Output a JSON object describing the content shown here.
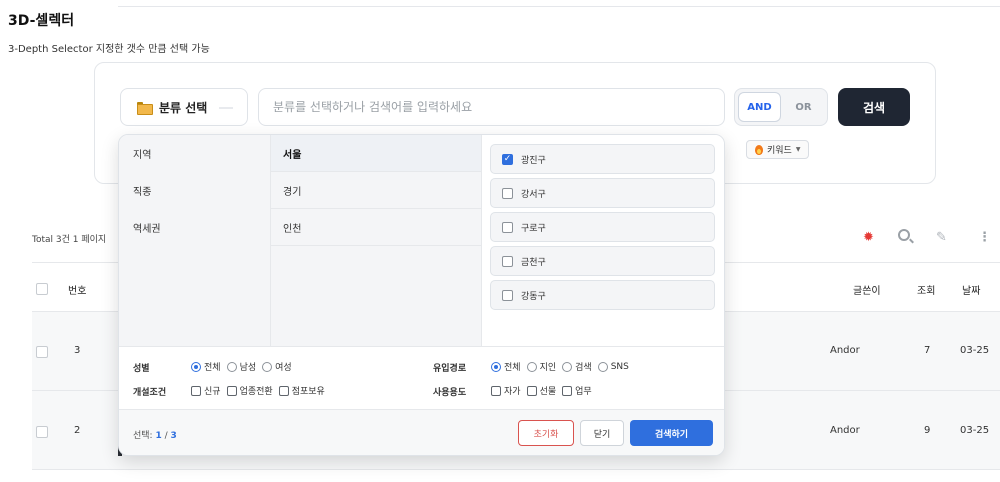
{
  "page": {
    "title": "3D-셀렉터",
    "description": "3-Depth Selector 지정한 갯수 만큼 선택 가능"
  },
  "search": {
    "category_button_label": "분류 선택",
    "placeholder": "분류를 선택하거나 검색어를 입력하세요",
    "logic_and": "AND",
    "logic_or": "OR",
    "logic_selected": "AND",
    "search_button": "검색",
    "keyword_chip": "키워드"
  },
  "dropdown": {
    "level1": [
      "지역",
      "직종",
      "역세권"
    ],
    "level2": [
      {
        "label": "서울",
        "selected": true
      },
      {
        "label": "경기",
        "selected": false
      },
      {
        "label": "인천",
        "selected": false
      }
    ],
    "level3": [
      {
        "label": "광진구",
        "checked": true
      },
      {
        "label": "강서구",
        "checked": false
      },
      {
        "label": "구로구",
        "checked": false
      },
      {
        "label": "금천구",
        "checked": false
      },
      {
        "label": "강동구",
        "checked": false
      }
    ],
    "filters": {
      "gender": {
        "label": "성별",
        "options": [
          "전체",
          "남성",
          "여성"
        ],
        "selected": "전체"
      },
      "channel": {
        "label": "유입경로",
        "options": [
          "전체",
          "지인",
          "검색",
          "SNS"
        ],
        "selected": "전체"
      },
      "condition": {
        "label": "개설조건",
        "options": [
          "신규",
          "업종전환",
          "점포보유"
        ]
      },
      "usage": {
        "label": "사용용도",
        "options": [
          "자가",
          "선물",
          "업무"
        ]
      }
    },
    "footer": {
      "selection_label": "선택:",
      "selection_count": "1",
      "selection_max": "3",
      "reset_label": "초기화",
      "close_label": "닫기",
      "apply_label": "검색하기"
    }
  },
  "list": {
    "total_text": "Total 3건 1 페이지",
    "headers": {
      "number": "번호",
      "author": "글쓴이",
      "views": "조회",
      "date": "날짜"
    },
    "rows": [
      {
        "number": "3",
        "author": "Andor",
        "views": "7",
        "date": "03-25"
      },
      {
        "number": "2",
        "author": "Andor",
        "views": "9",
        "date": "03-25"
      }
    ]
  },
  "icons": {
    "settings": "gear-icon",
    "search": "search-icon",
    "edit": "pencil-icon",
    "more": "more-vertical-icon"
  },
  "colors": {
    "primary": "#2f6fde",
    "dark_button": "#1f2633",
    "danger": "#d9534f"
  }
}
